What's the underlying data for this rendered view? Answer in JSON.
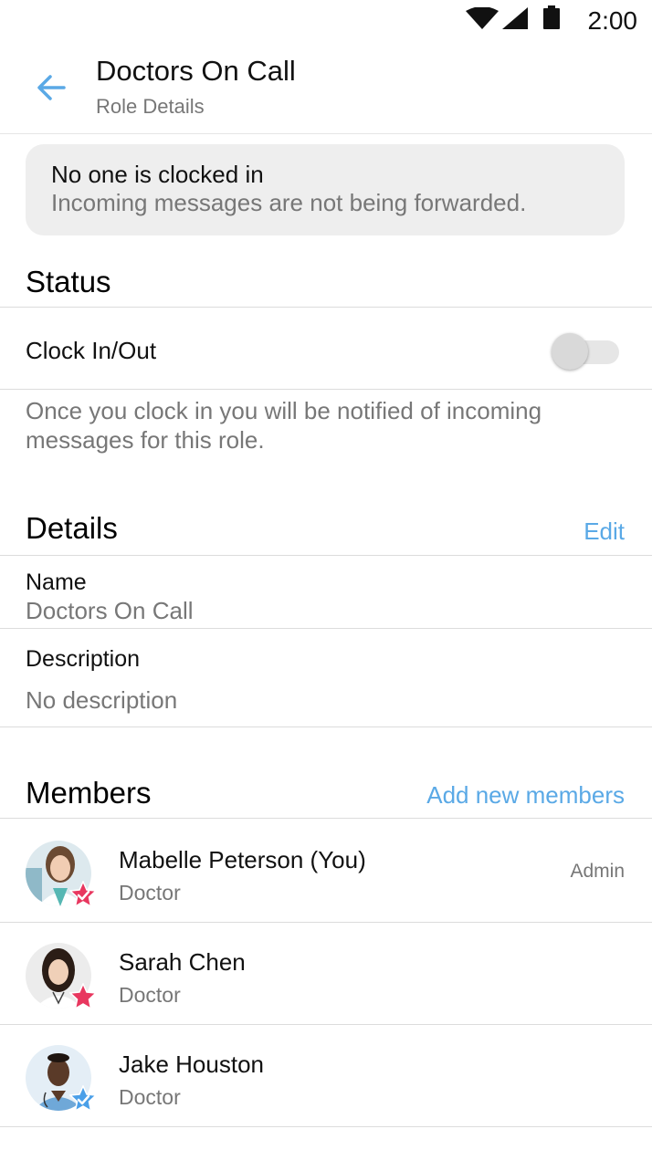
{
  "status_bar": {
    "time": "2:00"
  },
  "header": {
    "title": "Doctors On Call",
    "subtitle": "Role Details"
  },
  "banner": {
    "title": "No one is clocked in",
    "message": "Incoming messages are not being forwarded."
  },
  "status": {
    "heading": "Status",
    "clock_label": "Clock In/Out",
    "clock_on": false,
    "helper": "Once you clock in you will be notified of incoming messages for this role."
  },
  "details": {
    "heading": "Details",
    "edit_label": "Edit",
    "name_label": "Name",
    "name_value": "Doctors On Call",
    "description_label": "Description",
    "description_value": "No description"
  },
  "members": {
    "heading": "Members",
    "add_label": "Add new members",
    "list": [
      {
        "name": "Mabelle Peterson (You)",
        "role": "Doctor",
        "tag": "Admin",
        "badge_color": "#e8375f",
        "badge": "check-star-icon"
      },
      {
        "name": "Sarah Chen",
        "role": "Doctor",
        "tag": "",
        "badge_color": "#e8375f",
        "badge": "star-icon"
      },
      {
        "name": "Jake Houston",
        "role": "Doctor",
        "tag": "",
        "badge_color": "#4a9fe8",
        "badge": "check-star-icon"
      }
    ]
  },
  "colors": {
    "accent": "#5aa9e6",
    "muted": "#777777",
    "banner_bg": "#eeeeee"
  }
}
